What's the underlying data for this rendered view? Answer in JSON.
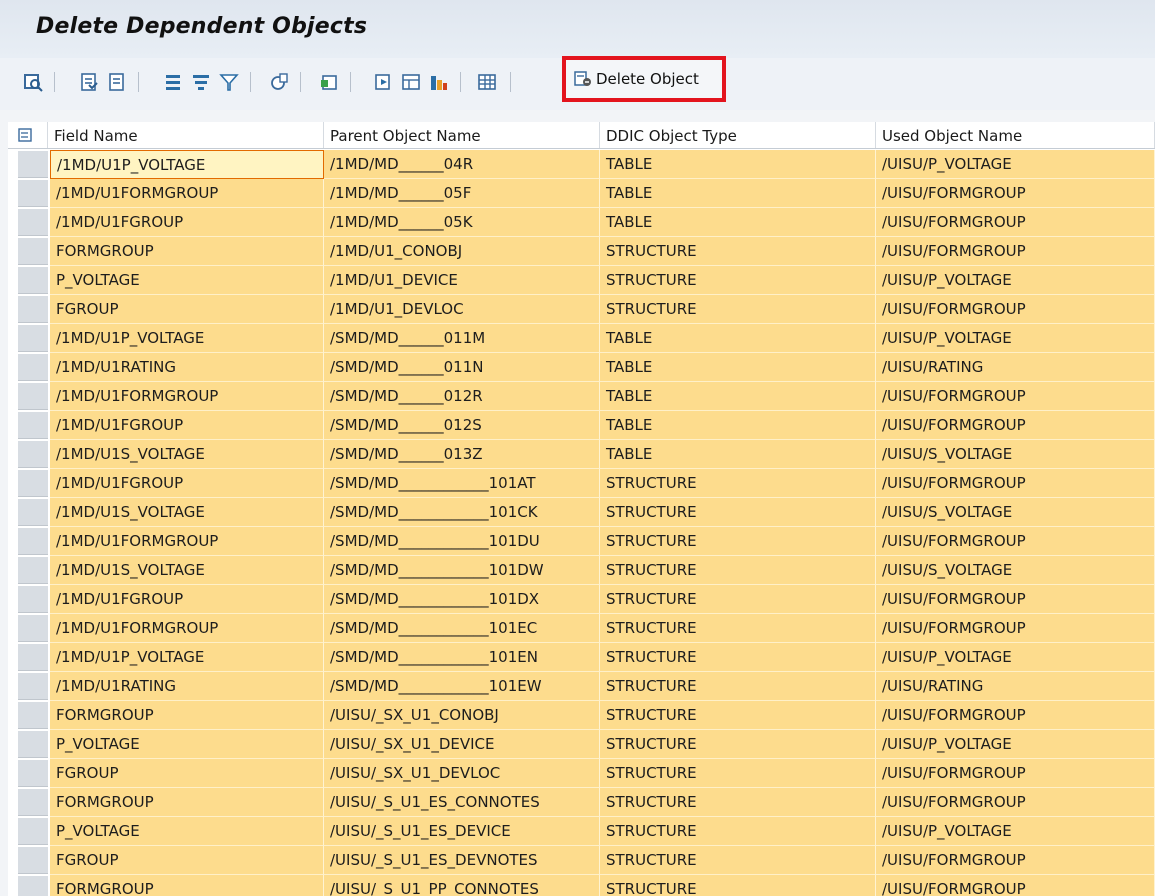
{
  "window": {
    "title": "Delete Dependent Objects"
  },
  "toolbar": {
    "icons": [
      "details-icon",
      "select-all-icon",
      "deselect-all-icon",
      "sort-ascending-icon",
      "sort-descending-icon",
      "filter-icon",
      "total-icon",
      "export-icon",
      "print-icon",
      "view-icon",
      "layout-icon",
      "chart-icon",
      "grid-icon"
    ],
    "delete_label": "Delete Object"
  },
  "table": {
    "columns": [
      "Field Name",
      "Parent Object Name",
      "DDIC Object Type",
      "Used Object Name"
    ],
    "rows": [
      [
        "/1MD/U1P_VOLTAGE",
        "/1MD/MD______04R",
        "TABLE",
        "/UISU/P_VOLTAGE"
      ],
      [
        "/1MD/U1FORMGROUP",
        "/1MD/MD______05F",
        "TABLE",
        "/UISU/FORMGROUP"
      ],
      [
        "/1MD/U1FGROUP",
        "/1MD/MD______05K",
        "TABLE",
        "/UISU/FORMGROUP"
      ],
      [
        "FORMGROUP",
        "/1MD/U1_CONOBJ",
        "STRUCTURE",
        "/UISU/FORMGROUP"
      ],
      [
        "P_VOLTAGE",
        "/1MD/U1_DEVICE",
        "STRUCTURE",
        "/UISU/P_VOLTAGE"
      ],
      [
        "FGROUP",
        "/1MD/U1_DEVLOC",
        "STRUCTURE",
        "/UISU/FORMGROUP"
      ],
      [
        "/1MD/U1P_VOLTAGE",
        "/SMD/MD______011M",
        "TABLE",
        "/UISU/P_VOLTAGE"
      ],
      [
        "/1MD/U1RATING",
        "/SMD/MD______011N",
        "TABLE",
        "/UISU/RATING"
      ],
      [
        "/1MD/U1FORMGROUP",
        "/SMD/MD______012R",
        "TABLE",
        "/UISU/FORMGROUP"
      ],
      [
        "/1MD/U1FGROUP",
        "/SMD/MD______012S",
        "TABLE",
        "/UISU/FORMGROUP"
      ],
      [
        "/1MD/U1S_VOLTAGE",
        "/SMD/MD______013Z",
        "TABLE",
        "/UISU/S_VOLTAGE"
      ],
      [
        "/1MD/U1FGROUP",
        "/SMD/MD____________101AT",
        "STRUCTURE",
        "/UISU/FORMGROUP"
      ],
      [
        "/1MD/U1S_VOLTAGE",
        "/SMD/MD____________101CK",
        "STRUCTURE",
        "/UISU/S_VOLTAGE"
      ],
      [
        "/1MD/U1FORMGROUP",
        "/SMD/MD____________101DU",
        "STRUCTURE",
        "/UISU/FORMGROUP"
      ],
      [
        "/1MD/U1S_VOLTAGE",
        "/SMD/MD____________101DW",
        "STRUCTURE",
        "/UISU/S_VOLTAGE"
      ],
      [
        "/1MD/U1FGROUP",
        "/SMD/MD____________101DX",
        "STRUCTURE",
        "/UISU/FORMGROUP"
      ],
      [
        "/1MD/U1FORMGROUP",
        "/SMD/MD____________101EC",
        "STRUCTURE",
        "/UISU/FORMGROUP"
      ],
      [
        "/1MD/U1P_VOLTAGE",
        "/SMD/MD____________101EN",
        "STRUCTURE",
        "/UISU/P_VOLTAGE"
      ],
      [
        "/1MD/U1RATING",
        "/SMD/MD____________101EW",
        "STRUCTURE",
        "/UISU/RATING"
      ],
      [
        "FORMGROUP",
        "/UISU/_SX_U1_CONOBJ",
        "STRUCTURE",
        "/UISU/FORMGROUP"
      ],
      [
        "P_VOLTAGE",
        "/UISU/_SX_U1_DEVICE",
        "STRUCTURE",
        "/UISU/P_VOLTAGE"
      ],
      [
        "FGROUP",
        "/UISU/_SX_U1_DEVLOC",
        "STRUCTURE",
        "/UISU/FORMGROUP"
      ],
      [
        "FORMGROUP",
        "/UISU/_S_U1_ES_CONNOTES",
        "STRUCTURE",
        "/UISU/FORMGROUP"
      ],
      [
        "P_VOLTAGE",
        "/UISU/_S_U1_ES_DEVICE",
        "STRUCTURE",
        "/UISU/P_VOLTAGE"
      ],
      [
        "FGROUP",
        "/UISU/_S_U1_ES_DEVNOTES",
        "STRUCTURE",
        "/UISU/FORMGROUP"
      ],
      [
        "FORMGROUP",
        "/UISU/_S_U1_PP_CONNOTES",
        "STRUCTURE",
        "/UISU/FORMGROUP"
      ]
    ]
  }
}
